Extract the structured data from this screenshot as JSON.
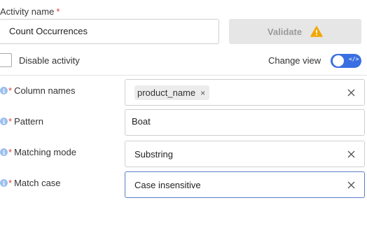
{
  "activity": {
    "label": "Activity name",
    "required_mark": "*",
    "name_value": "Count Occurrences"
  },
  "validate": {
    "label": "Validate",
    "icon": "warning-triangle-icon",
    "icon_color": "#f0a800"
  },
  "disable": {
    "label": "Disable activity",
    "checked": false
  },
  "change_view": {
    "label": "Change view",
    "enabled": true,
    "toggle_glyph": "</>",
    "accent": "#3a6fe2"
  },
  "fields": {
    "column_names": {
      "label": "Column names",
      "required_mark": "*",
      "chip": "product_name",
      "chip_remove": "×"
    },
    "pattern": {
      "label": "Pattern",
      "required_mark": "*",
      "value": "Boat"
    },
    "matching_mode": {
      "label": "Matching mode",
      "required_mark": "*",
      "value": "Substring"
    },
    "match_case": {
      "label": "Match case",
      "required_mark": "*",
      "value": "Case insensitive"
    }
  },
  "info_glyph": "i"
}
